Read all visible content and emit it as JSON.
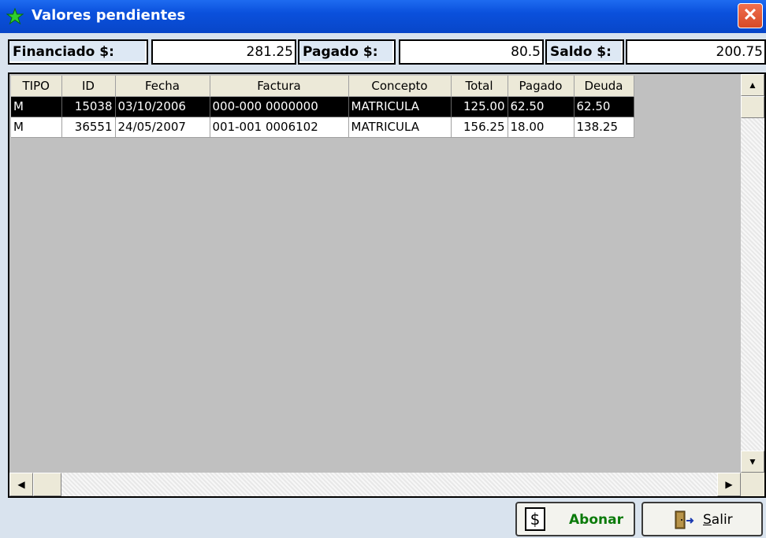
{
  "window": {
    "title": "Valores pendientes",
    "close_glyph": "✕",
    "title_icon": "green-star-icon"
  },
  "summary": {
    "financiado_label": "Financiado $:",
    "financiado_value": "281.25",
    "pagado_label": "Pagado $:",
    "pagado_value": "80.5",
    "saldo_label": "Saldo $:",
    "saldo_value": "200.75"
  },
  "grid": {
    "columns": [
      "TIPO",
      "ID",
      "Fecha",
      "Factura",
      "Concepto",
      "Total",
      "Pagado",
      "Deuda"
    ],
    "rows": [
      [
        "M",
        "15038",
        "03/10/2006",
        "000-000 0000000",
        "MATRICULA",
        "125.00",
        "62.50",
        "62.50"
      ],
      [
        "M",
        "36551",
        "24/05/2007",
        "001-001 0006102",
        "MATRICULA",
        "156.25",
        "18.00",
        "138.25"
      ]
    ],
    "selected_row": 0
  },
  "buttons": {
    "abonar_label": "Abonar",
    "abonar_icon_glyph": "$",
    "salir_first": "S",
    "salir_rest": "alir"
  },
  "colors": {
    "titlebar": "#0a50dc",
    "selected_row": "#000000",
    "abonar_text": "#0a7a0a"
  }
}
